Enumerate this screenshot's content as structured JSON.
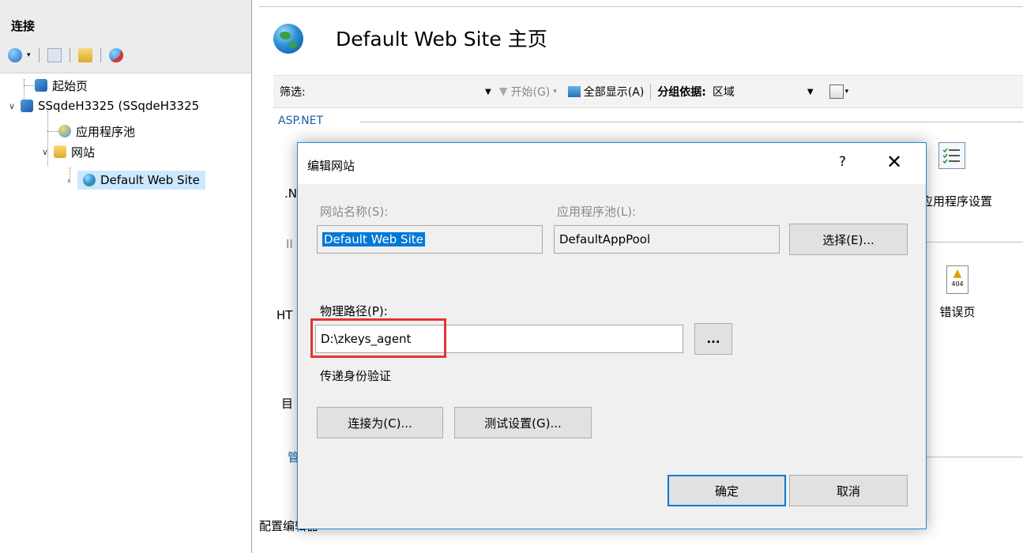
{
  "left_pane": {
    "title": "连接",
    "toolbar": [
      "connect-icon",
      "save-icon",
      "up-folder-icon",
      "disconnect-icon"
    ],
    "tree": {
      "start_page": "起始页",
      "server": "SSqdeH3325 (SSqdeH3325",
      "app_pools": "应用程序池",
      "sites": "网站",
      "default_site": "Default Web Site"
    }
  },
  "main": {
    "title": "Default Web Site 主页",
    "filter": {
      "label": "筛选:",
      "start": "开始(G)",
      "show_all": "全部显示(A)",
      "group_by_label": "分组依据:",
      "group_by_value": "区域"
    },
    "section_aspnet": "ASP.NET",
    "app_settings": "应用程序设置",
    "error_pages": "错误页",
    "error_icon_text": "404",
    "peek": {
      "net": ".N",
      "ii": "II",
      "ht": "HT",
      "mu": "目",
      "guan": "管"
    },
    "bottom_fragment": "配置编辑器"
  },
  "dialog": {
    "title": "编辑网站",
    "help": "?",
    "close": "✕",
    "site_name_label": "网站名称(S):",
    "site_name_value": "Default Web Site",
    "app_pool_label": "应用程序池(L):",
    "app_pool_value": "DefaultAppPool",
    "select_button": "选择(E)...",
    "physical_path_label": "物理路径(P):",
    "physical_path_value": "D:\\zkeys_agent",
    "browse_button": "...",
    "pass_through_label": "传递身份验证",
    "connect_as_button": "连接为(C)...",
    "test_settings_button": "测试设置(G)...",
    "ok_button": "确定",
    "cancel_button": "取消"
  },
  "colors": {
    "accent": "#0078d7",
    "highlight": "#e03535",
    "section": "#1a5fa8"
  }
}
